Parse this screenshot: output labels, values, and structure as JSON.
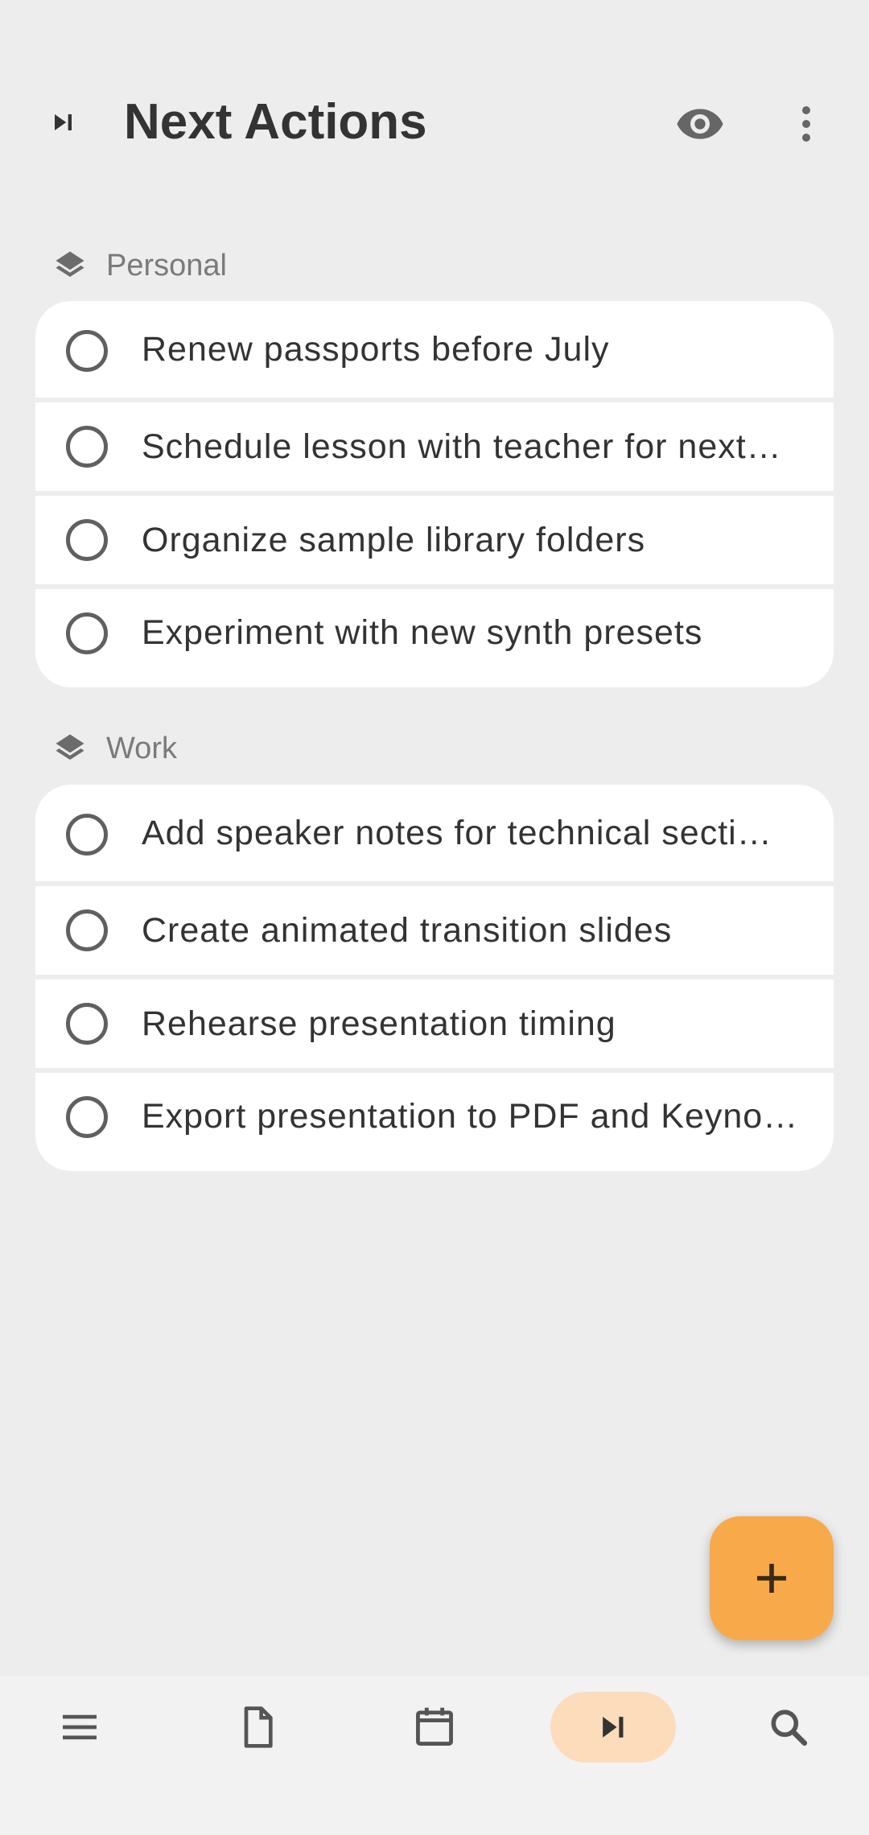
{
  "header": {
    "title": "Next Actions",
    "leading_icon": "skip-next-icon",
    "visibility_icon": "eye-icon",
    "menu_icon": "more-vert-icon"
  },
  "sections": [
    {
      "name": "Personal",
      "icon": "layers-icon",
      "items": [
        "Renew passports before July",
        "Schedule lesson with teacher for next…",
        "Organize sample library folders",
        "Experiment with new synth presets"
      ]
    },
    {
      "name": "Work",
      "icon": "layers-icon",
      "items": [
        "Add speaker notes for technical secti…",
        "Create animated transition slides",
        "Rehearse presentation timing",
        "Export presentation to PDF and Keyno…"
      ]
    }
  ],
  "fab": {
    "icon": "plus-icon"
  },
  "bottom_nav": {
    "items": [
      {
        "icon": "menu-icon",
        "active": false
      },
      {
        "icon": "document-icon",
        "active": false
      },
      {
        "icon": "calendar-icon",
        "active": false
      },
      {
        "icon": "skip-next-icon",
        "active": true
      },
      {
        "icon": "search-icon",
        "active": false
      }
    ]
  },
  "colors": {
    "background": "#ededed",
    "card": "#ffffff",
    "accent": "#f8a94a",
    "active_nav": "#fddcbc"
  }
}
